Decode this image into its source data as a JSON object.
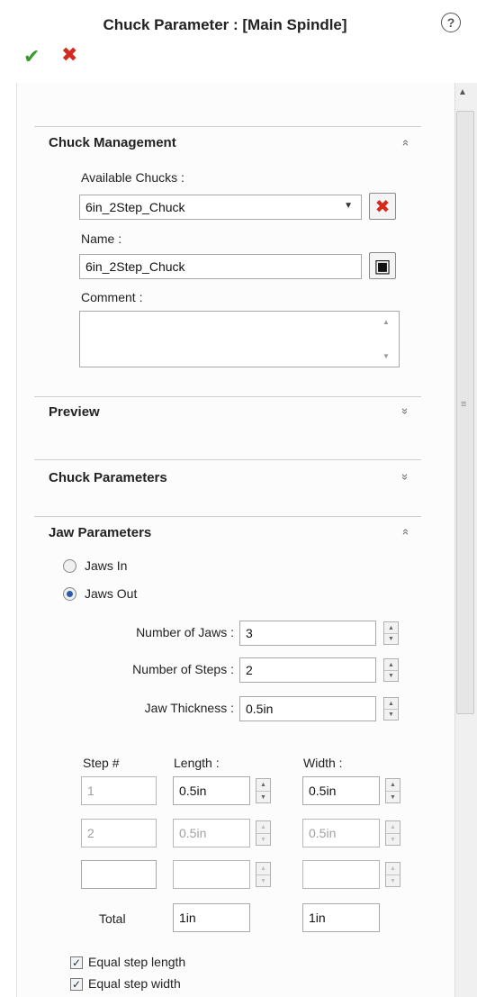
{
  "header": {
    "title": "Chuck Parameter : [Main Spindle]",
    "help_glyph": "?",
    "ok_glyph": "✔",
    "cancel_glyph": "✖"
  },
  "chuck_management": {
    "title": "Chuck Management",
    "collapse_glyph": "»",
    "available_label": "Available Chucks :",
    "available_value": "6in_2Step_Chuck",
    "name_label": "Name :",
    "name_value": "6in_2Step_Chuck",
    "comment_label": "Comment :",
    "comment_value": ""
  },
  "preview": {
    "title": "Preview",
    "expand_glyph": "»"
  },
  "chuck_parameters": {
    "title": "Chuck Parameters",
    "expand_glyph": "»"
  },
  "jaw_parameters": {
    "title": "Jaw Parameters",
    "collapse_glyph": "»",
    "jaws_in_label": "Jaws In",
    "jaws_out_label": "Jaws Out",
    "selected": "Jaws Out",
    "number_of_jaws_label": "Number of Jaws :",
    "number_of_jaws": "3",
    "number_of_steps_label": "Number of Steps :",
    "number_of_steps": "2",
    "jaw_thickness_label": "Jaw Thickness :",
    "jaw_thickness": "0.5in",
    "step_header": "Step #",
    "length_header": "Length :",
    "width_header": "Width :",
    "rows": [
      {
        "step": "1",
        "length": "0.5in",
        "width": "0.5in"
      },
      {
        "step": "2",
        "length": "0.5in",
        "width": "0.5in"
      },
      {
        "step": "",
        "length": "",
        "width": ""
      }
    ],
    "total_label": "Total",
    "total_length": "1in",
    "total_width": "1in",
    "equal_length_label": "Equal step length",
    "equal_width_label": "Equal step width",
    "equal_length_checked": true,
    "equal_width_checked": true
  },
  "icons": {
    "delete_glyph": "✖",
    "save_glyph": "▣",
    "check_glyph": "✓",
    "spin_up": "▲",
    "spin_down": "▼",
    "combo_arrow": "▼",
    "scroll_up": "▲",
    "scroll_grip": "≡"
  },
  "colors": {
    "ok": "#3a9a2e",
    "cancel": "#d42a1e",
    "radio_selected": "#2a5ca8"
  }
}
